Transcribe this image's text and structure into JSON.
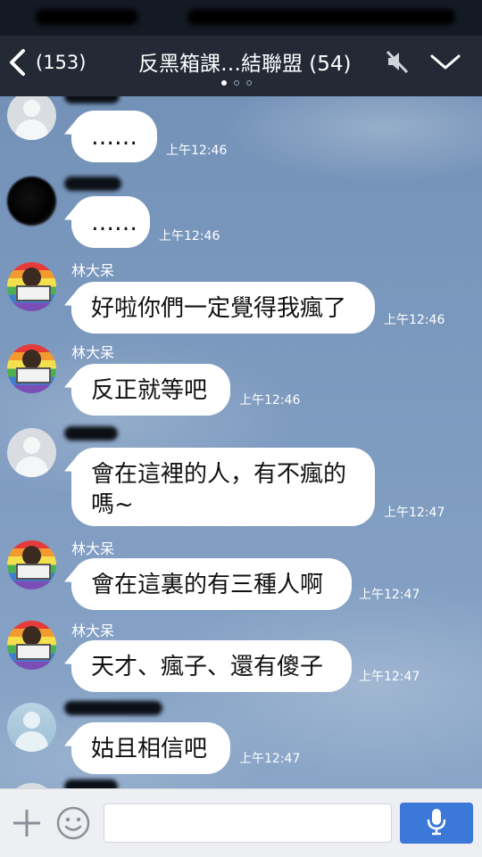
{
  "header": {
    "back_count": "(153)",
    "title": "反黑箱課…結聯盟 (54)",
    "pages": 3,
    "active_page": 1
  },
  "messages": [
    {
      "avatar": "default",
      "sender": "",
      "text": "……",
      "time": "上午12:46"
    },
    {
      "avatar": "dark",
      "sender": "",
      "text": "……",
      "time": "上午12:46"
    },
    {
      "avatar": "rainbow",
      "sender": "林大呆",
      "text": "好啦你們一定覺得我瘋了",
      "time": "上午12:46"
    },
    {
      "avatar": "rainbow",
      "sender": "林大呆",
      "text": "反正就等吧",
      "time": "上午12:46"
    },
    {
      "avatar": "default",
      "sender": "",
      "text": "會在這裡的人，有不瘋的",
      "text2": "嗎~",
      "time": "上午12:47"
    },
    {
      "avatar": "rainbow",
      "sender": "林大呆",
      "text": "會在這裏的有三種人啊",
      "time": "上午12:47"
    },
    {
      "avatar": "rainbow",
      "sender": "林大呆",
      "text": "天才、瘋子、還有傻子",
      "time": "上午12:47"
    },
    {
      "avatar": "light",
      "sender": "",
      "text": "姑且相信吧",
      "time": "上午12:47"
    }
  ],
  "input": {
    "placeholder": ""
  },
  "colors": {
    "header_bg": "#232a36",
    "bubble": "#ffffff",
    "send_button": "#3c78d8"
  },
  "icons": [
    "back-chevron-icon",
    "mute-icon",
    "chevron-down-icon",
    "plus-icon",
    "emoji-icon",
    "microphone-icon"
  ]
}
